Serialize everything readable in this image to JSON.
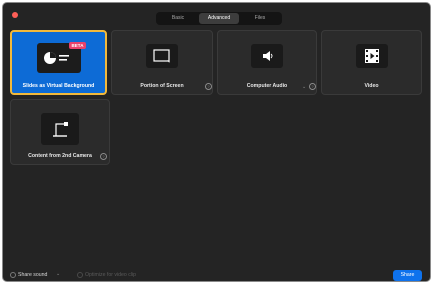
{
  "tabs": [
    {
      "label": "Basic",
      "active": false
    },
    {
      "label": "Advanced",
      "active": true
    },
    {
      "label": "Files",
      "active": false
    }
  ],
  "tiles": [
    {
      "label": "Slides as Virtual Background",
      "icon": "slides-pie-icon",
      "badge": "BETA",
      "selected": true
    },
    {
      "label": "Portion of Screen",
      "icon": "screen-portion-icon",
      "help": "?",
      "selected": false
    },
    {
      "label": "Computer Audio",
      "icon": "speaker-icon",
      "dropdown": "⌄",
      "help": "?",
      "selected": false
    },
    {
      "label": "Video",
      "icon": "film-icon",
      "selected": false
    },
    {
      "label": "Content from 2nd Camera",
      "icon": "document-camera-icon",
      "help": "?",
      "selected": false
    }
  ],
  "bottom": {
    "share_sound_label": "Share sound",
    "share_sound_chevron": "⌄",
    "optimize_label": "Optimize for video clip",
    "share_button": "Share"
  },
  "colors": {
    "accent": "#0e72ed",
    "selected_tile": "#0d6bd6",
    "selected_outline": "#f2b93b",
    "badge": "#e8426b"
  }
}
